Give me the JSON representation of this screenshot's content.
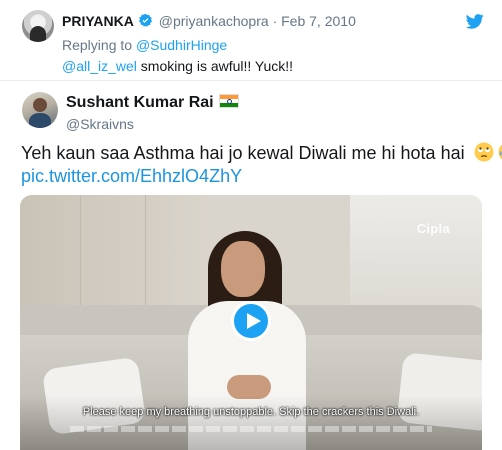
{
  "reply_tweet": {
    "name": "PRIYANKA",
    "handle": "@priyankachopra",
    "separator": "·",
    "date": "Feb 7, 2010",
    "replying_label": "Replying to",
    "replying_handle": "@SudhirHinge",
    "mention": "@all_iz_wel",
    "text": " smoking is awful!! Yuck!!"
  },
  "quoted_tweet": {
    "name": "Sushant Kumar Rai",
    "handle": "@Skraivns",
    "text": "Yeh kaun saa Asthma hai jo kewal Diwali me hi hota hai",
    "link": "pic.twitter.com/EhhzlO4ZhY"
  },
  "video": {
    "brand_watermark": "Cipla",
    "subtitle": "Please keep my breathing unstoppable. Skip the crackers this Diwali."
  },
  "icons": {
    "verified": "verified-badge-icon",
    "twitter": "twitter-bird-icon",
    "flag": "india-flag-icon",
    "emojis": [
      "rolling-eyes-emoji",
      "crying-laughing-emoji"
    ],
    "play": "play-icon"
  },
  "colors": {
    "link": "#1da1f2",
    "muted": "#657786",
    "text": "#14171a"
  }
}
